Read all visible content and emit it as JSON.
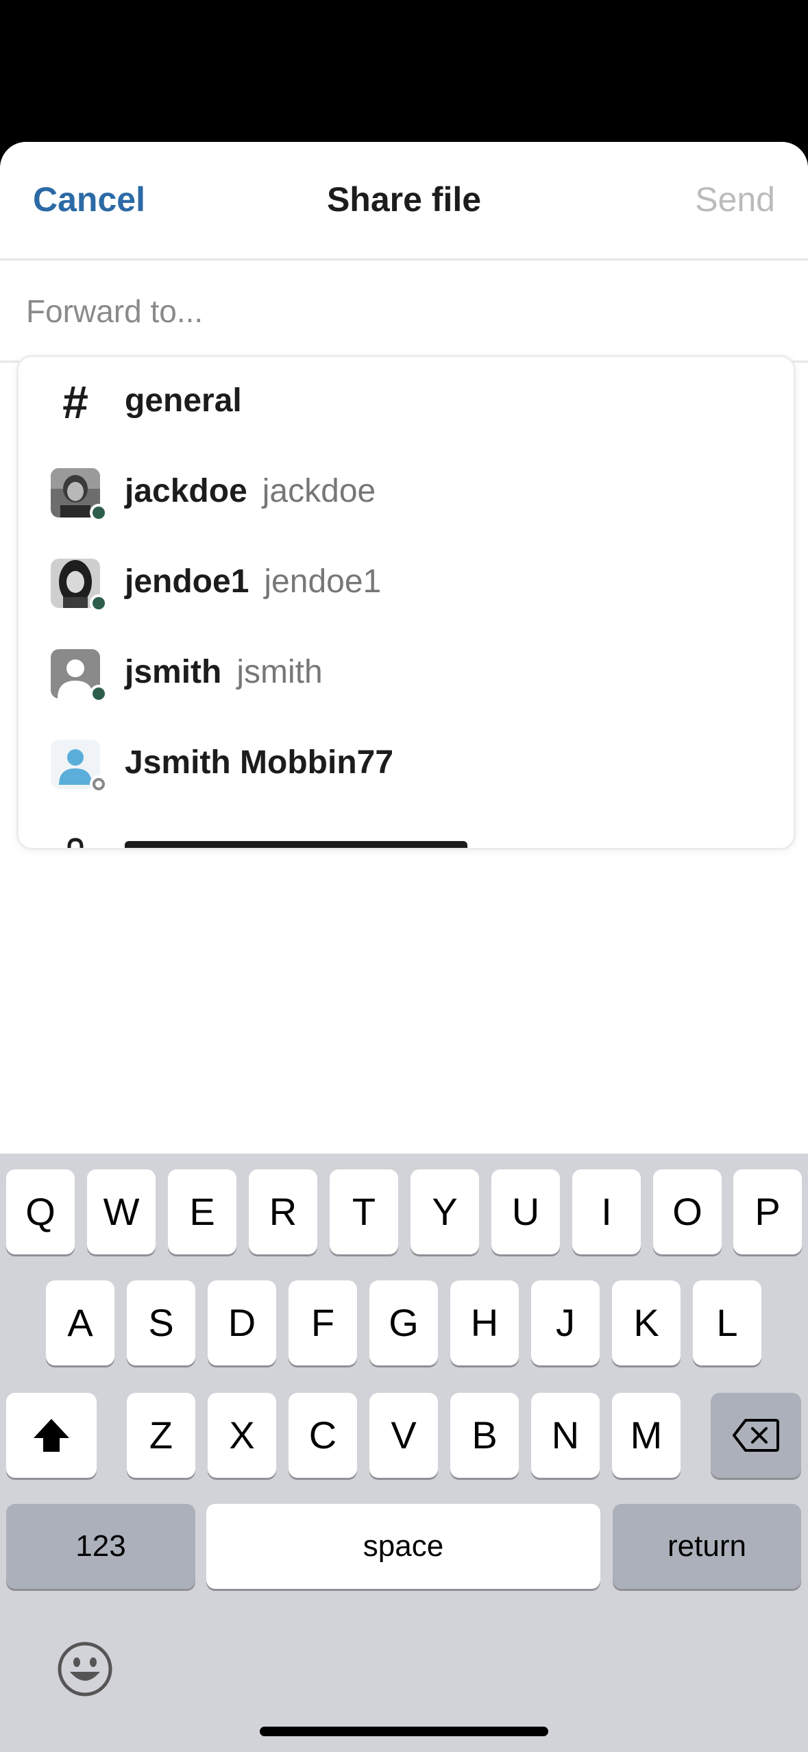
{
  "header": {
    "cancel_label": "Cancel",
    "title": "Share file",
    "send_label": "Send"
  },
  "forward": {
    "placeholder": "Forward to..."
  },
  "suggestions": [
    {
      "name": "general",
      "type": "channel"
    },
    {
      "name": "jackdoe",
      "handle": "jackdoe",
      "status": "online"
    },
    {
      "name": "jendoe1",
      "handle": "jendoe1",
      "status": "online"
    },
    {
      "name": "jsmith",
      "handle": "jsmith",
      "status": "online"
    },
    {
      "name": "Jsmith Mobbin77",
      "status": "away"
    }
  ],
  "keyboard": {
    "row1": [
      "Q",
      "W",
      "E",
      "R",
      "T",
      "Y",
      "U",
      "I",
      "O",
      "P"
    ],
    "row2": [
      "A",
      "S",
      "D",
      "F",
      "G",
      "H",
      "J",
      "K",
      "L"
    ],
    "row3": [
      "Z",
      "X",
      "C",
      "V",
      "B",
      "N",
      "M"
    ],
    "numbers_label": "123",
    "space_label": "space",
    "return_label": "return"
  },
  "colors": {
    "accent": "#2b6aa5",
    "online": "#2e5e4b",
    "keyboard_bg": "#d1d3d9"
  }
}
